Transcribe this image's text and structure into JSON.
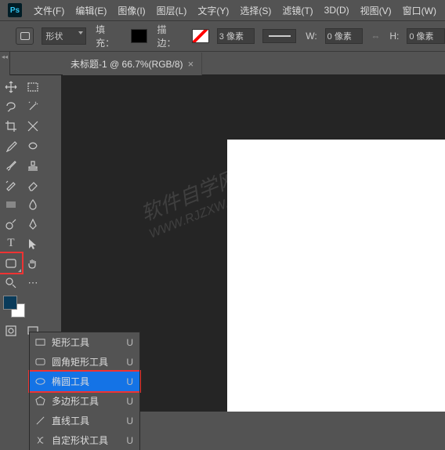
{
  "menu": {
    "file": "文件(F)",
    "edit": "编辑(E)",
    "image": "图像(I)",
    "layer": "图层(L)",
    "type": "文字(Y)",
    "select": "选择(S)",
    "filter": "滤镜(T)",
    "threed": "3D(D)",
    "view": "视图(V)",
    "window": "窗口(W)"
  },
  "options": {
    "shape_mode": "形状",
    "fill_label": "填充：",
    "stroke_label": "描边：",
    "stroke_value": "3 像素",
    "w_label": "W:",
    "h_label": "H:",
    "zero_px": "0 像素"
  },
  "tab": {
    "title": "未标题-1 @ 66.7%(RGB/8)"
  },
  "flyout": {
    "items": [
      {
        "label": "矩形工具",
        "shortcut": "U",
        "icon": "rect"
      },
      {
        "label": "圆角矩形工具",
        "shortcut": "U",
        "icon": "roundrect"
      },
      {
        "label": "椭圆工具",
        "shortcut": "U",
        "icon": "ellipse",
        "selected": true
      },
      {
        "label": "多边形工具",
        "shortcut": "U",
        "icon": "polygon"
      },
      {
        "label": "直线工具",
        "shortcut": "U",
        "icon": "line"
      },
      {
        "label": "自定形状工具",
        "shortcut": "U",
        "icon": "custom"
      }
    ]
  },
  "watermark": {
    "line1": "软件自学网",
    "line2": "WWW.RJZXW.COM"
  }
}
